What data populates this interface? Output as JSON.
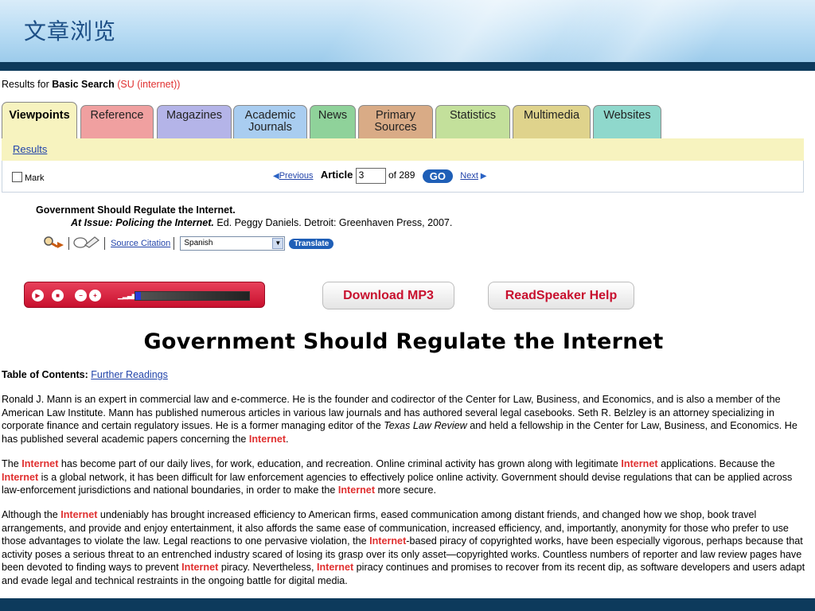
{
  "slide": {
    "title": "文章浏览"
  },
  "results": {
    "prefix": "Results for ",
    "mode": "Basic Search",
    "query": "(SU (internet))"
  },
  "tabs": [
    {
      "label": "Viewpoints",
      "color": "#f7f3bf",
      "active": true
    },
    {
      "label": "Reference",
      "color": "#f0a0a0"
    },
    {
      "label": "Magazines",
      "color": "#b4b4e8"
    },
    {
      "label": "Academic\nJournals",
      "color": "#a9cdf0"
    },
    {
      "label": "News",
      "color": "#8fd29a"
    },
    {
      "label": "Primary\nSources",
      "color": "#d9ab86"
    },
    {
      "label": "Statistics",
      "color": "#c3e09b"
    },
    {
      "label": "Multimedia",
      "color": "#dfd38c"
    },
    {
      "label": "Websites",
      "color": "#8fd8cc"
    }
  ],
  "subnav": {
    "results_link": "Results"
  },
  "nav": {
    "mark_label": "Mark",
    "previous_label": "Previous",
    "article_label": "Article",
    "article_value": "3",
    "of_total": "of 289",
    "go_label": "GO",
    "next_label": "Next"
  },
  "citation": {
    "title": "Government Should Regulate the Internet.",
    "source_title": "At Issue: Policing the Internet.",
    "source_rest": " Ed. Peggy Daniels. Detroit: Greenhaven Press, 2007."
  },
  "tools": {
    "source_citation": "Source Citation",
    "language": "Spanish",
    "translate_label": "Translate"
  },
  "readspeaker": {
    "player_progress": 0.05,
    "download_label": "Download MP3",
    "help_label": "ReadSpeaker Help"
  },
  "document": {
    "heading": "Government Should Regulate the Internet",
    "toc_label": "Table of Contents:",
    "toc_link": "Further Readings"
  },
  "paragraphs": [
    [
      {
        "t": "Ronald J. Mann is an expert in commercial law and e-commerce. He is the founder and codirector of the Center for Law, Business, and Economics, and is also a member of the American Law Institute. Mann has published numerous articles in various law journals and has authored several legal casebooks. Seth R. Belzley is an attorney specializing in corporate finance and certain regulatory issues. He is a former managing editor of the "
      },
      {
        "t": "Texas Law Review",
        "i": true
      },
      {
        "t": " and held a fellowship in the Center for Law, Business, and Economics. He has published several academic papers concerning the "
      },
      {
        "t": "Internet",
        "h": true
      },
      {
        "t": "."
      }
    ],
    [
      {
        "t": "The "
      },
      {
        "t": "Internet",
        "h": true
      },
      {
        "t": " has become part of our daily lives, for work, education, and recreation. Online criminal activity has grown along with legitimate "
      },
      {
        "t": "Internet",
        "h": true
      },
      {
        "t": " applications. Because the "
      },
      {
        "t": "Internet",
        "h": true
      },
      {
        "t": " is a global network, it has been difficult for law enforcement agencies to effectively police online activity. Government should devise regulations that can be applied across law-enforcement jurisdictions and national boundaries, in order to make the "
      },
      {
        "t": "Internet",
        "h": true
      },
      {
        "t": " more secure."
      }
    ],
    [
      {
        "t": "Although the "
      },
      {
        "t": "Internet",
        "h": true
      },
      {
        "t": " undeniably has brought increased efficiency to American firms, eased communication among distant friends, and changed how we shop, book travel arrangements, and provide and enjoy entertainment, it also affords the same ease of communication, increased efficiency, and, importantly, anonymity for those who prefer to use those advantages to violate the law. Legal reactions to one pervasive violation, the "
      },
      {
        "t": "Internet",
        "h": true
      },
      {
        "t": "-based piracy of copyrighted works, have been especially vigorous, perhaps because that activity poses a serious threat to an entrenched industry scared of losing its grasp over its only asset—copyrighted works. Countless numbers of reporter and law review pages have been devoted to finding ways to prevent "
      },
      {
        "t": "Internet",
        "h": true
      },
      {
        "t": " piracy. Nevertheless, "
      },
      {
        "t": "Internet",
        "h": true
      },
      {
        "t": " piracy continues and promises to recover from its recent dip, as software developers and users adapt and evade legal and technical restraints in the ongoing battle for digital media."
      }
    ]
  ]
}
